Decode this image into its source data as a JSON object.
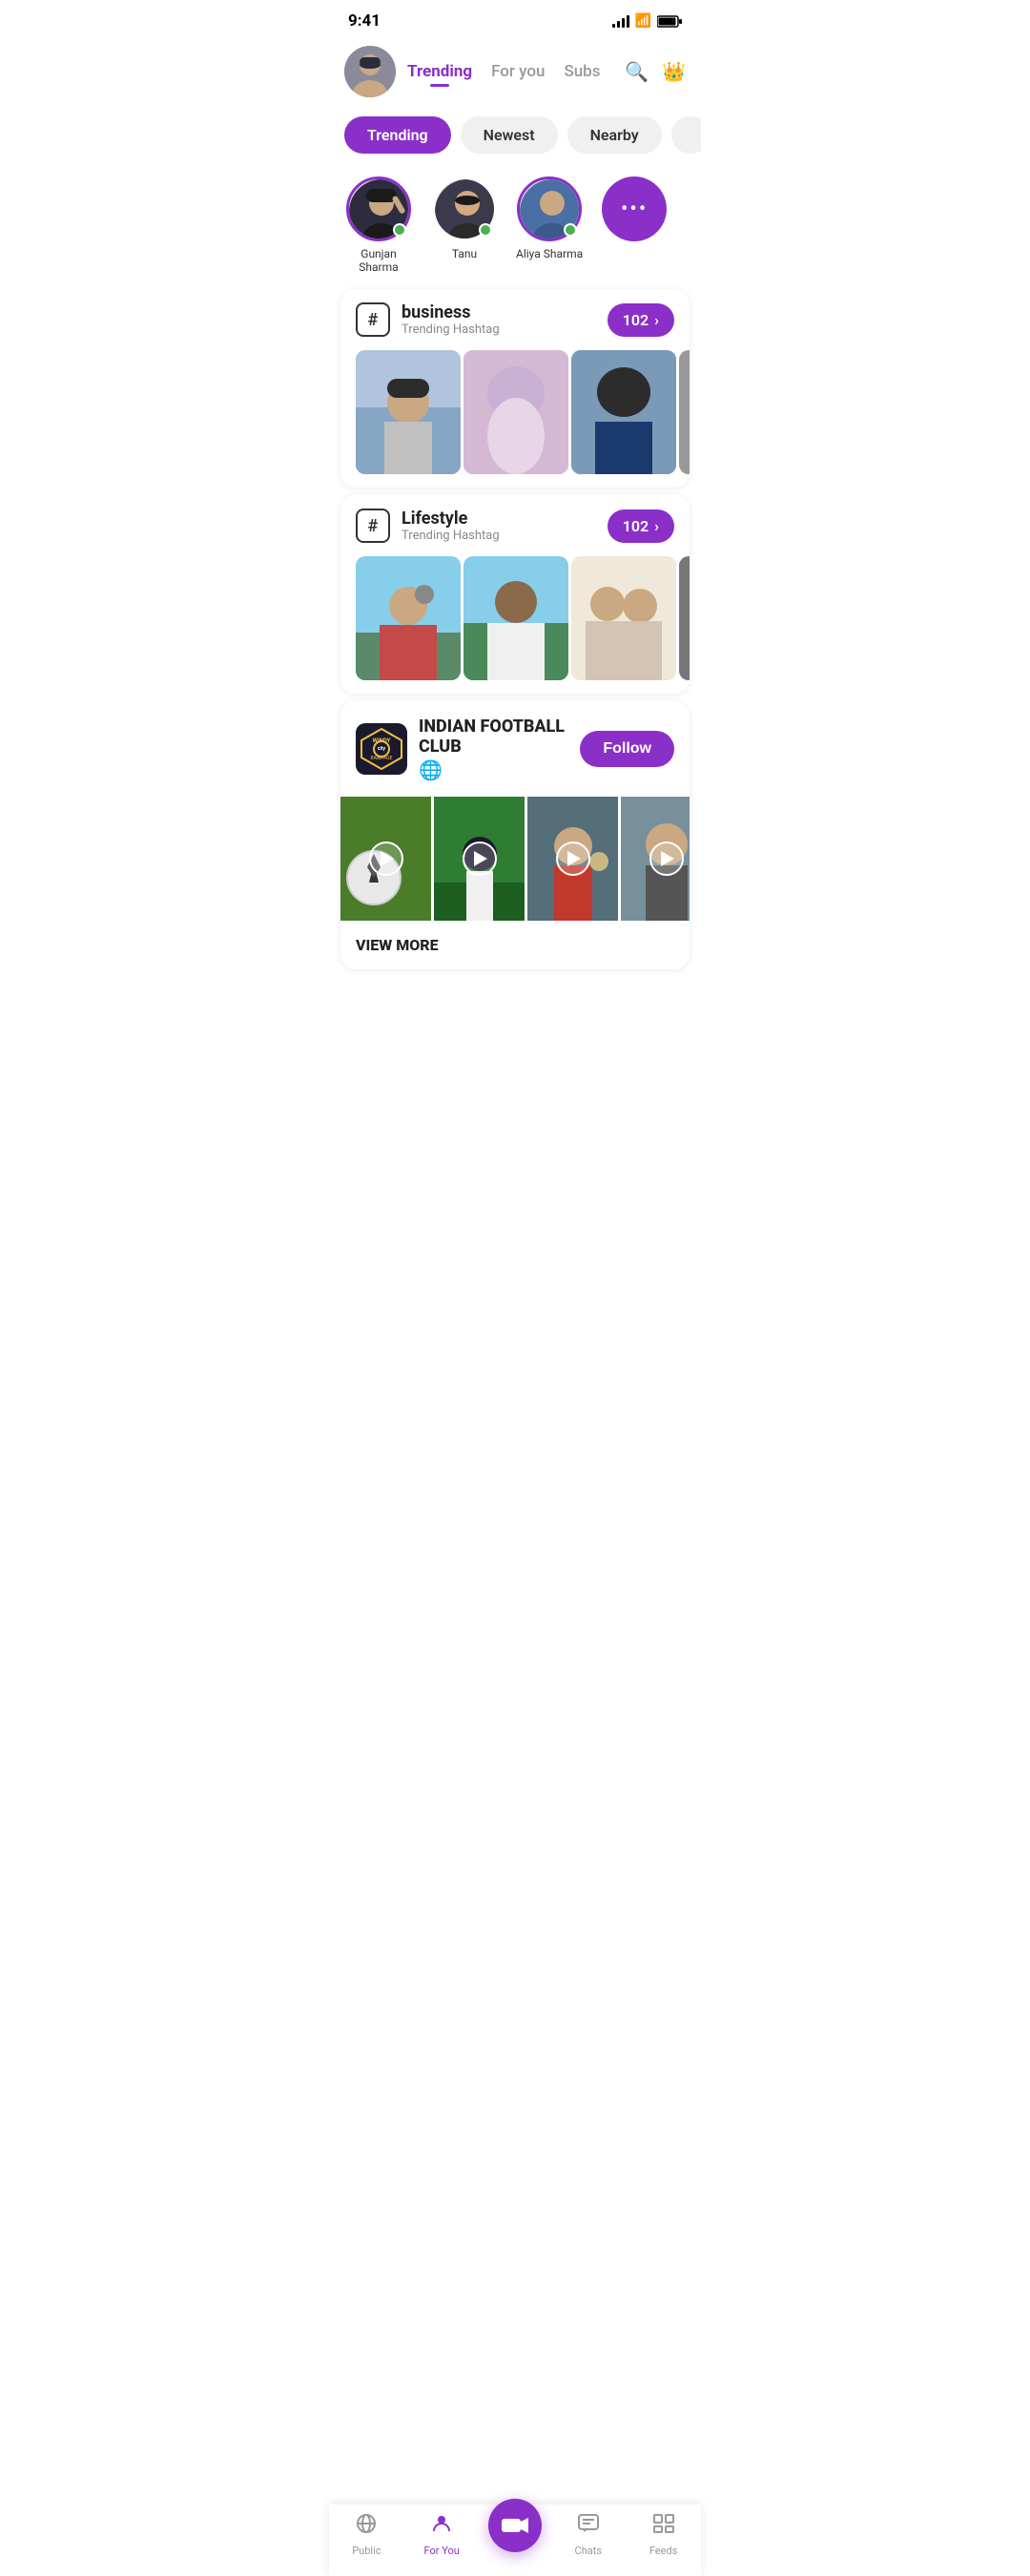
{
  "status_bar": {
    "time": "9:41"
  },
  "header": {
    "trending_label": "Trending",
    "for_you_label": "For you",
    "subs_label": "Subs"
  },
  "filter_tabs": [
    {
      "label": "Trending",
      "active": true
    },
    {
      "label": "Newest",
      "active": false
    },
    {
      "label": "Nearby",
      "active": false
    }
  ],
  "stories": [
    {
      "name": "Gunjan Sharma",
      "online": true,
      "has_ring": true
    },
    {
      "name": "Tanu",
      "online": true,
      "has_ring": false
    },
    {
      "name": "Aliya Sharma",
      "online": true,
      "has_ring": true
    },
    {
      "name": "more",
      "is_more": true
    }
  ],
  "hashtag_cards": [
    {
      "name": "business",
      "sub_label": "Trending Hashtag",
      "count": "102"
    },
    {
      "name": "Lifestyle",
      "sub_label": "Trending Hashtag",
      "count": "102"
    }
  ],
  "club": {
    "name": "INDIAN FOOTBALL CLUB",
    "follow_label": "Follow",
    "view_more_label": "VIEW MORE"
  },
  "bottom_nav": [
    {
      "label": "Public",
      "icon": "📡",
      "active": false
    },
    {
      "label": "For You",
      "icon": "👤",
      "active": true
    },
    {
      "label": "Go Live",
      "icon": "🎥",
      "active": false,
      "is_center": true
    },
    {
      "label": "Chats",
      "icon": "💬",
      "active": false
    },
    {
      "label": "Feeds",
      "icon": "☰",
      "active": false
    }
  ]
}
